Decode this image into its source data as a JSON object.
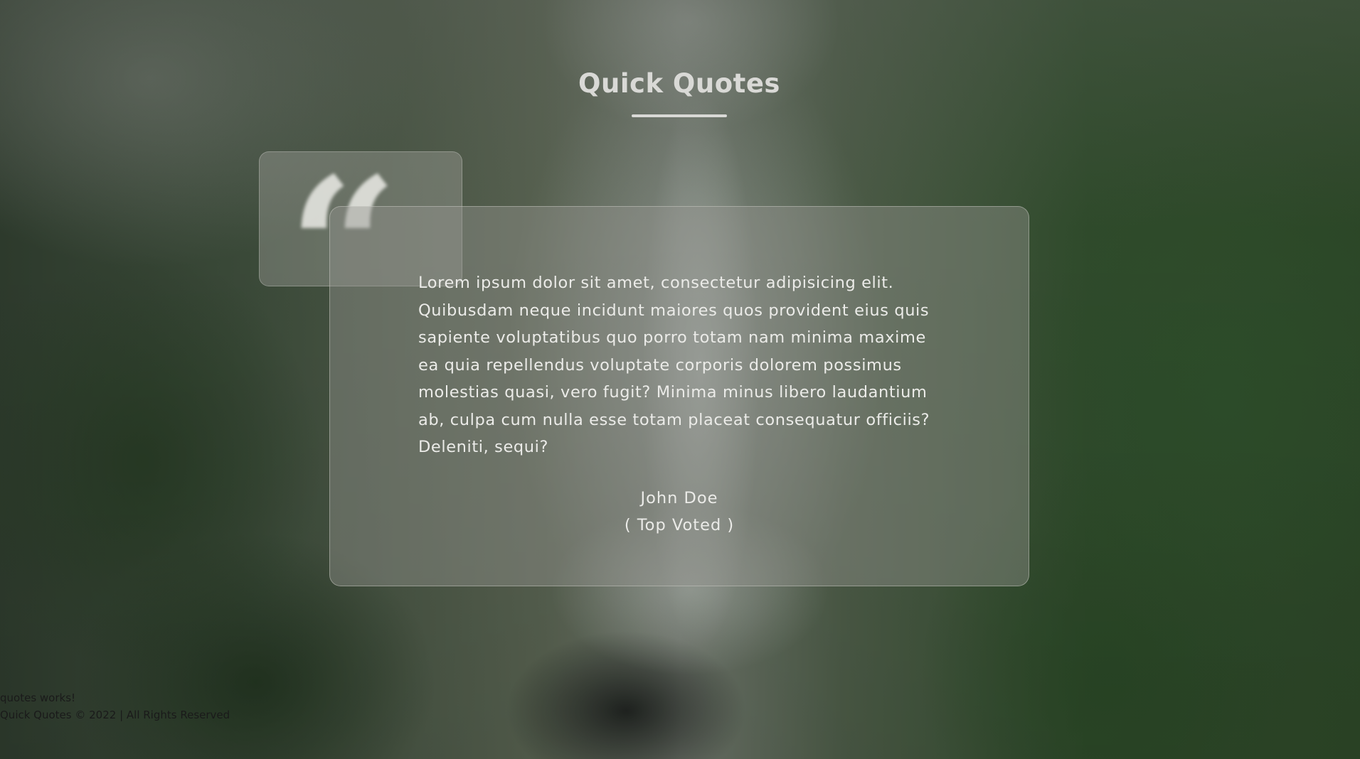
{
  "header": {
    "title": "Quick Quotes"
  },
  "quote": {
    "mark": "“",
    "text": "Lorem ipsum dolor sit amet, consectetur adipisicing elit. Quibusdam neque incidunt maiores quos provident eius quis sapiente voluptatibus quo porro totam nam minima maxime ea quia repellendus voluptate corporis dolorem possimus molestias quasi, vero fugit? Minima minus libero laudantium ab, culpa cum nulla esse totam placeat consequatur officiis? Deleniti, sequi?",
    "author": "John Doe",
    "tag": "( Top Voted )"
  },
  "footer": {
    "line1": "quotes works!",
    "line2": "Quick Quotes © 2022 | All Rights Reserved"
  },
  "colors": {
    "title_text": "#d9d9d6",
    "card_text": "#ebebe8",
    "footer_text": "#1a1a1a"
  }
}
